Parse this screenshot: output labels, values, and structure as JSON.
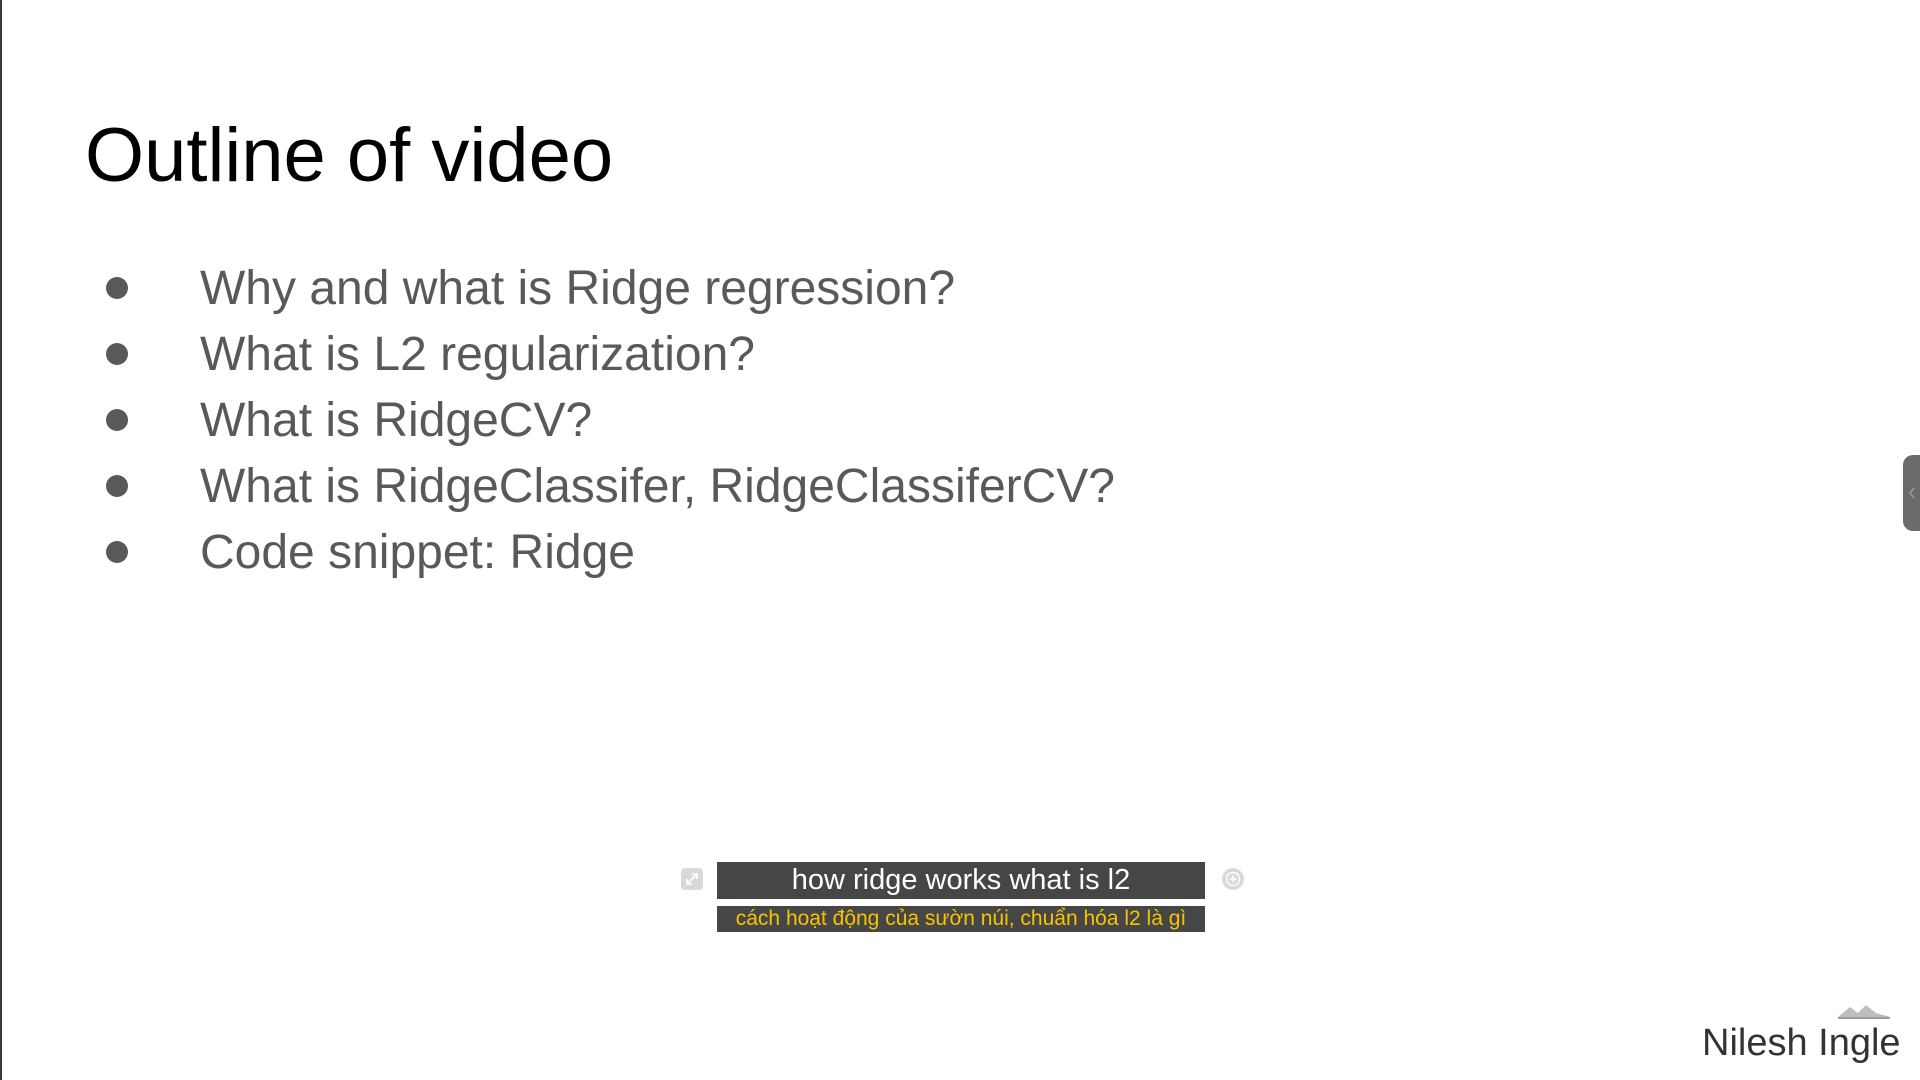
{
  "slide": {
    "title": "Outline of video",
    "bullets": [
      "Why and what is Ridge regression?",
      "What is L2 regularization?",
      "What is RidgeCV?",
      "What is RidgeClassifer, RidgeClassiferCV?",
      "Code snippet: Ridge"
    ],
    "author": "Nilesh Ingle"
  },
  "captions": {
    "original": "how ridge works what is l2",
    "translation": "cách hoạt động của sườn núi, chuẩn hóa l2 là gì"
  },
  "icons": {
    "caption_expand": "expand-icon",
    "caption_add": "add-circle-icon",
    "side_panel": "chevron-left-icon",
    "watermark": "logo-icon"
  },
  "colors": {
    "background": "#ffffff",
    "title": "#000000",
    "bullet_text": "#595959",
    "caption_translation": "#f5c400"
  }
}
